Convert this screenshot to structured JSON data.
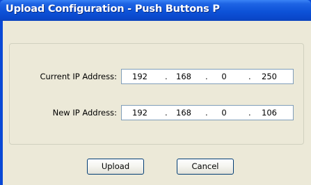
{
  "window": {
    "title": "Upload Configuration - Push Buttons P"
  },
  "form": {
    "current_ip": {
      "label": "Current IP Address:",
      "octets": [
        "192",
        "168",
        "0",
        "250"
      ]
    },
    "new_ip": {
      "label": "New IP Address:",
      "octets": [
        "192",
        "168",
        "0",
        "106"
      ]
    },
    "separator": "."
  },
  "buttons": {
    "upload_label": "Upload",
    "cancel_label": "Cancel"
  },
  "colors": {
    "titlebar": "#0a49d6",
    "dialog_background": "#ece9d8",
    "button_border": "#003c74",
    "input_border": "#7f9db9"
  }
}
